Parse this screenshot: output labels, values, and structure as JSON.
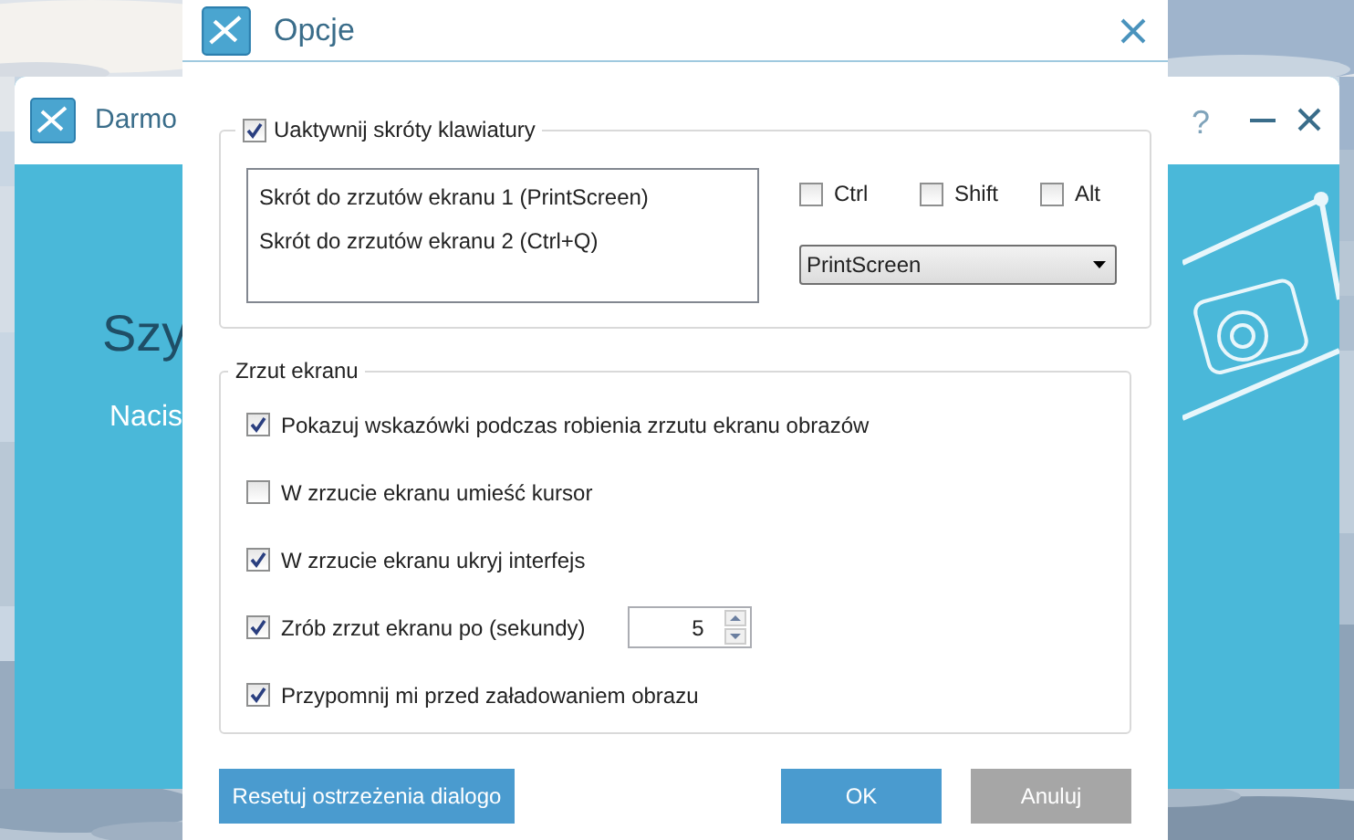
{
  "background_window": {
    "title": "Darmo",
    "help": "?",
    "heading": "Szy",
    "subtitle": "Nacis"
  },
  "dialog": {
    "title": "Opcje",
    "hotkeys": {
      "label": "Uaktywnij skróty klawiatury",
      "checked": true,
      "shortcuts": [
        {
          "label": "Skrót do zrzutów ekranu 1 (PrintScreen)"
        },
        {
          "label": "Skrót do zrzutów ekranu 2 (Ctrl+Q)"
        }
      ],
      "modifiers": [
        {
          "label": "Ctrl",
          "checked": false
        },
        {
          "label": "Shift",
          "checked": false
        },
        {
          "label": "Alt",
          "checked": false
        }
      ],
      "key": "PrintScreen"
    },
    "capture": {
      "title": "Zrzut ekranu",
      "options": [
        {
          "kind": "checkbox",
          "label": "Pokazuj wskazówki podczas robienia zrzutu ekranu obrazów",
          "checked": true
        },
        {
          "kind": "checkbox",
          "label": "W zrzucie ekranu umieść kursor",
          "checked": false
        },
        {
          "kind": "checkbox",
          "label": "W zrzucie ekranu ukryj interfejs",
          "checked": true
        },
        {
          "kind": "delay",
          "label": "Zrób zrzut ekranu po (sekundy)",
          "checked": true,
          "value": "5"
        },
        {
          "kind": "checkbox",
          "label": "Przypomnij mi przed załadowaniem obrazu",
          "checked": true
        }
      ]
    },
    "buttons": [
      {
        "kind": "reset",
        "label": "Resetuj ostrzeżenia dialogo"
      },
      {
        "kind": "primary",
        "label": "OK"
      },
      {
        "kind": "cancel",
        "label": "Anuluj"
      }
    ]
  }
}
